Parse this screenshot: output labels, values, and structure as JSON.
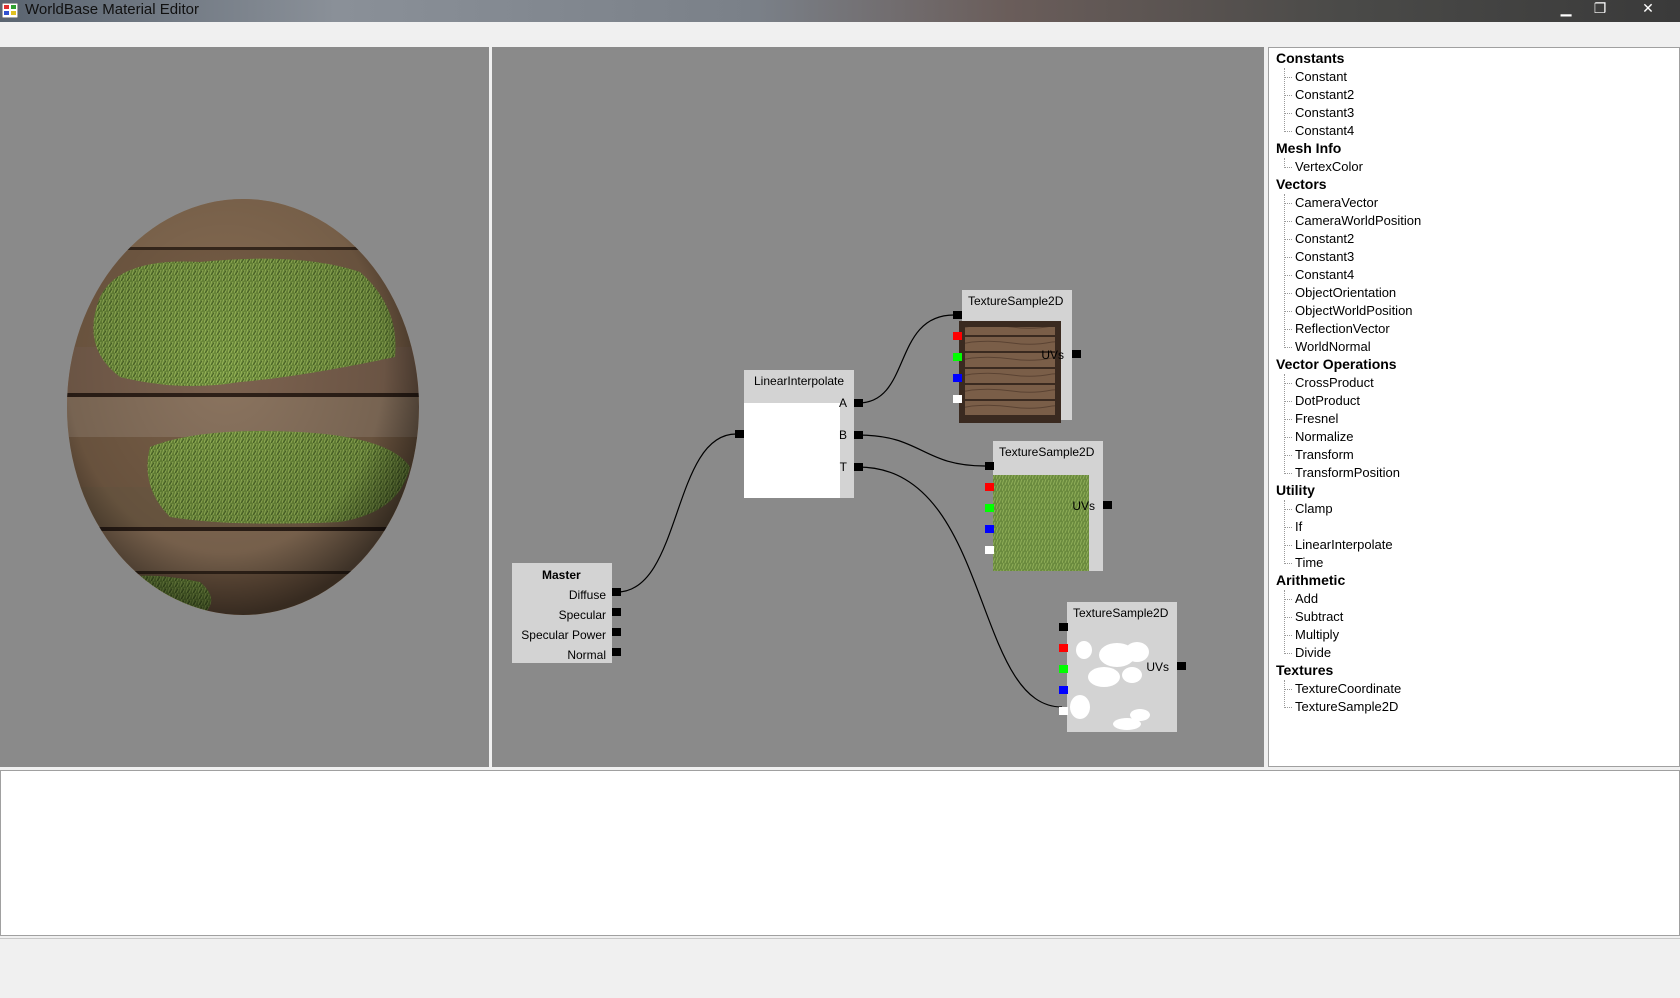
{
  "window": {
    "title": "WorldBase Material Editor",
    "min_icon": "minimize-icon",
    "max_icon": "maximize-icon",
    "close_icon": "close-icon"
  },
  "graph": {
    "nodes": {
      "master": {
        "title": "Master",
        "inputs": [
          "Diffuse",
          "Specular",
          "Specular Power",
          "Normal"
        ]
      },
      "lerp": {
        "title": "LinearInterpolate",
        "inputs": [
          "A",
          "B",
          "T"
        ]
      },
      "tex1": {
        "title": "TextureSample2D",
        "uv_label": "UVs",
        "preview": "wood-crate-texture"
      },
      "tex2": {
        "title": "TextureSample2D",
        "uv_label": "UVs",
        "preview": "grass-texture"
      },
      "tex3": {
        "title": "TextureSample2D",
        "uv_label": "UVs",
        "preview": "cloud-mask-texture"
      }
    },
    "channel_colors": [
      "#000000",
      "#ff0000",
      "#00ff00",
      "#0000ff",
      "#ffffff"
    ]
  },
  "palette": {
    "categories": [
      {
        "name": "Constants",
        "items": [
          "Constant",
          "Constant2",
          "Constant3",
          "Constant4"
        ]
      },
      {
        "name": "Mesh Info",
        "items": [
          "VertexColor"
        ]
      },
      {
        "name": "Vectors",
        "items": [
          "CameraVector",
          "CameraWorldPosition",
          "Constant2",
          "Constant3",
          "Constant4",
          "ObjectOrientation",
          "ObjectWorldPosition",
          "ReflectionVector",
          "WorldNormal"
        ]
      },
      {
        "name": "Vector Operations",
        "items": [
          "CrossProduct",
          "DotProduct",
          "Fresnel",
          "Normalize",
          "Transform",
          "TransformPosition"
        ]
      },
      {
        "name": "Utility",
        "items": [
          "Clamp",
          "If",
          "LinearInterpolate",
          "Time"
        ]
      },
      {
        "name": "Arithmetic",
        "items": [
          "Add",
          "Subtract",
          "Multiply",
          "Divide"
        ]
      },
      {
        "name": "Textures",
        "items": [
          "TextureCoordinate",
          "TextureSample2D"
        ]
      }
    ]
  },
  "colors": {
    "viewport_bg": "#8a8a8a",
    "node_bg": "#d3d3d3",
    "wire": "#000000"
  }
}
